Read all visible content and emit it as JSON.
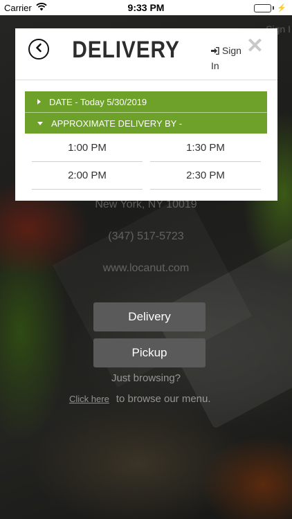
{
  "status_bar": {
    "carrier": "Carrier",
    "time": "9:33 PM",
    "charging_symbol": "⚡"
  },
  "background": {
    "sign_in_hint": "Sign I",
    "address": "New York, NY 10019",
    "phone": "(347) 517-5723",
    "website": "www.locanut.com",
    "delivery_button": "Delivery",
    "pickup_button": "Pickup",
    "browsing_text": "Just browsing?",
    "click_here_link": "Click here",
    "browse_menu_text": "to browse our menu."
  },
  "modal": {
    "title": "DELIVERY",
    "sign_in_label": "Sign In",
    "close_symbol": "✕",
    "date_row": "DATE - Today 5/30/2019",
    "approx_row": "APPROXIMATE DELIVERY BY -",
    "time_options": [
      "1:00 PM",
      "1:30 PM",
      "2:00 PM",
      "2:30 PM"
    ],
    "accent_color": "#6ea12a"
  },
  "icons": {
    "back": "chevron-left-circle-icon",
    "sign_in": "sign-in-icon",
    "close": "close-icon",
    "wifi": "wifi-icon",
    "battery": "battery-icon"
  }
}
